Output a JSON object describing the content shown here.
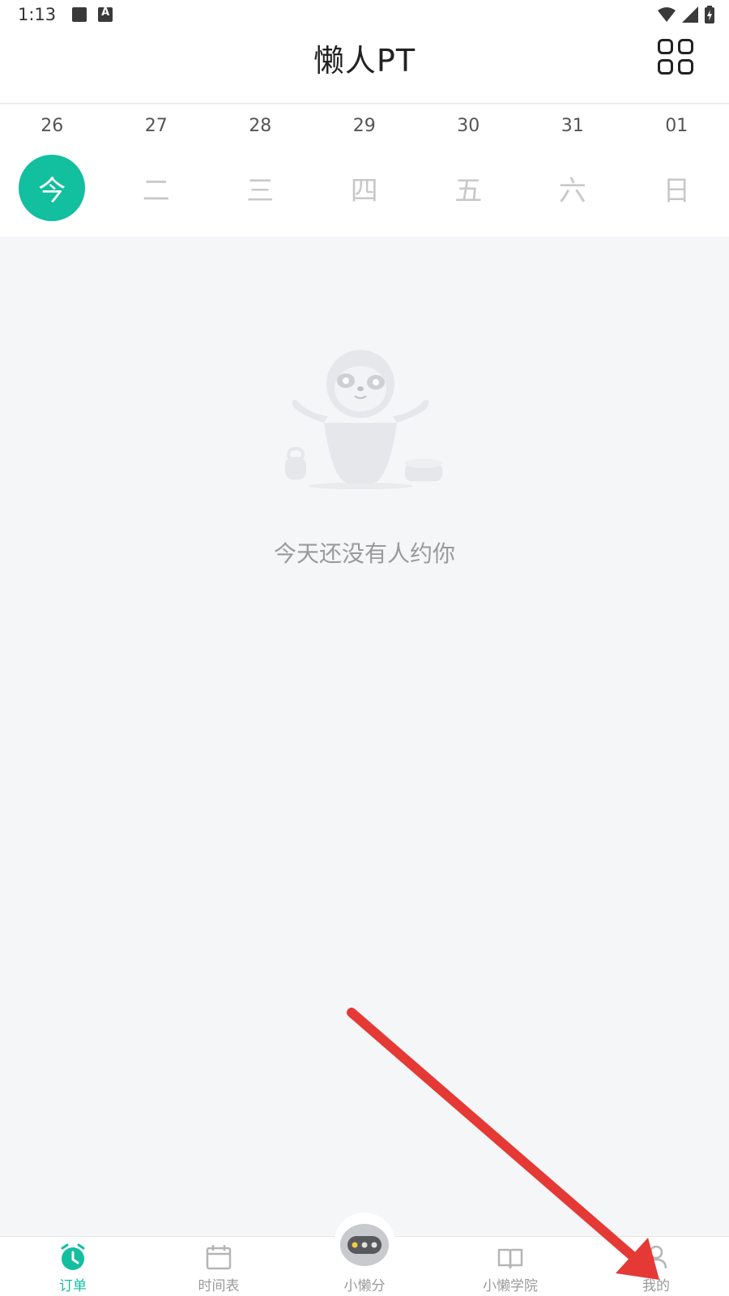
{
  "status_bar": {
    "time": "1:13"
  },
  "header": {
    "title": "懒人PT"
  },
  "week": [
    {
      "date": "26",
      "label": "今",
      "active": true
    },
    {
      "date": "27",
      "label": "二"
    },
    {
      "date": "28",
      "label": "三"
    },
    {
      "date": "29",
      "label": "四"
    },
    {
      "date": "30",
      "label": "五"
    },
    {
      "date": "31",
      "label": "六"
    },
    {
      "date": "01",
      "label": "日"
    }
  ],
  "empty": {
    "message": "今天还没有人约你"
  },
  "nav": {
    "items": [
      {
        "label": "订单",
        "icon": "alarm-clock-icon",
        "active": true
      },
      {
        "label": "时间表",
        "icon": "calendar-icon"
      },
      {
        "label": "小懒分",
        "icon": "robot-score-icon"
      },
      {
        "label": "小懒学院",
        "icon": "book-icon"
      },
      {
        "label": "我的",
        "icon": "profile-icon"
      }
    ]
  },
  "colors": {
    "accent": "#12bf9f",
    "annotation": "#e53935"
  }
}
